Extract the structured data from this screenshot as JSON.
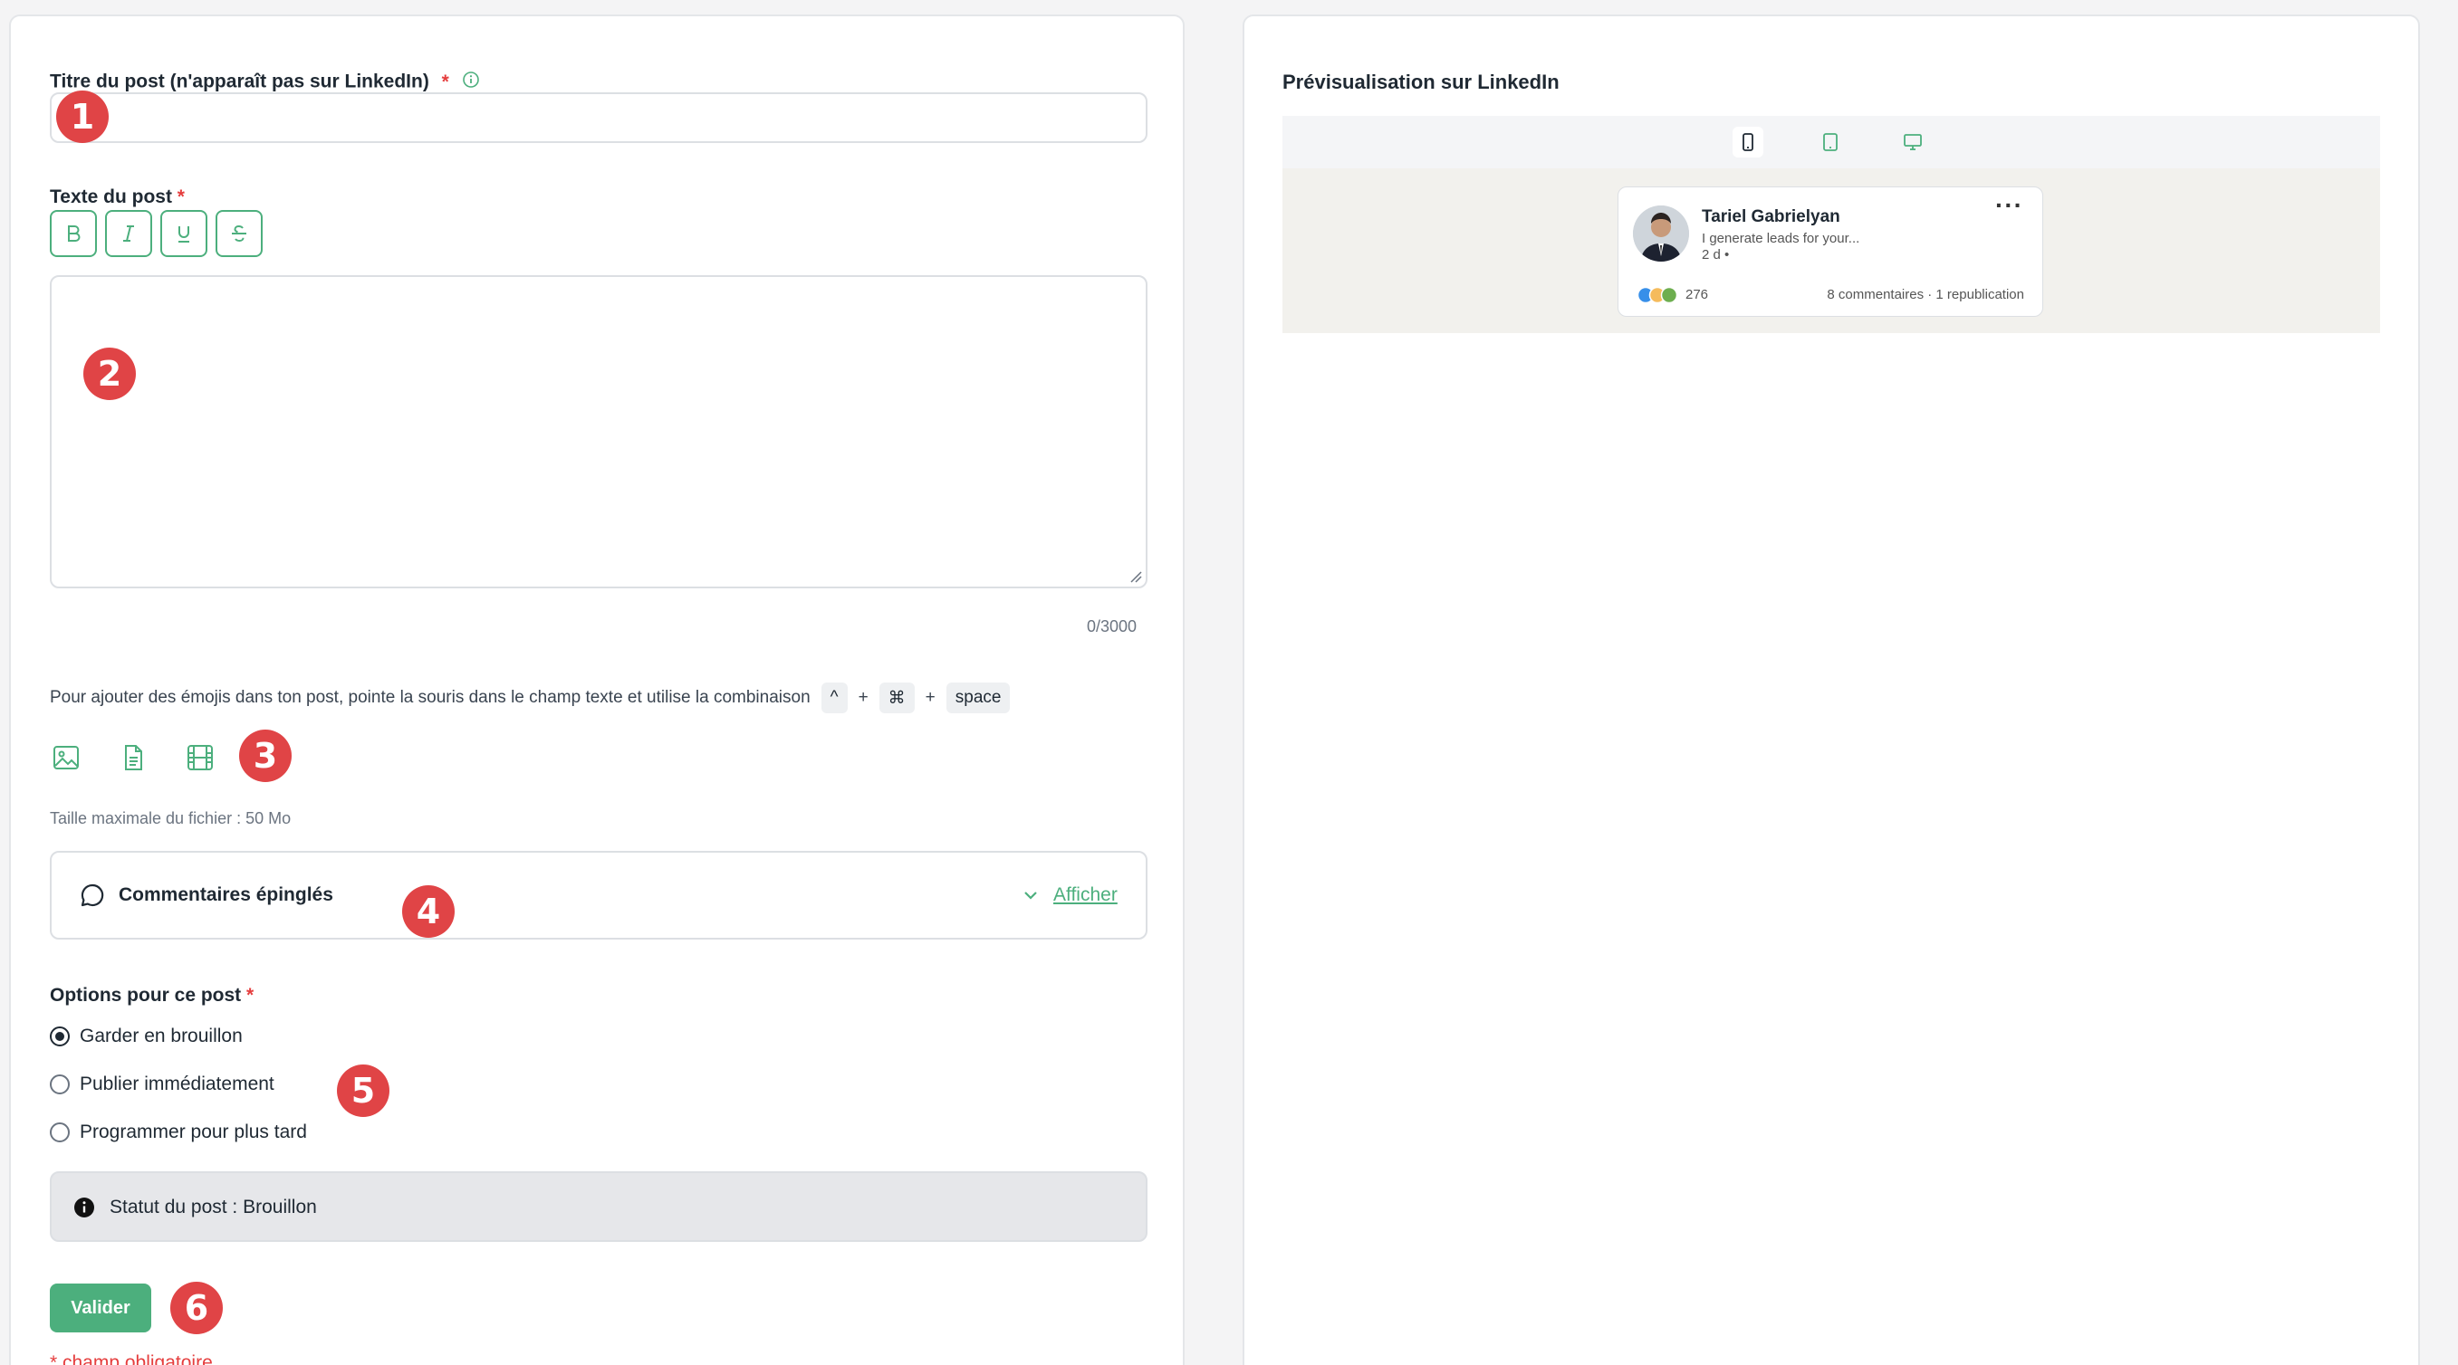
{
  "form": {
    "title_label": "Titre du post (n'apparaît pas sur LinkedIn)",
    "required_mark": "*",
    "title_value": "",
    "text_label": "Texte du post",
    "text_value": "",
    "char_count": "0/3000",
    "emoji_hint": "Pour ajouter des émojis dans ton post, pointe la souris dans le champ texte et utilise la combinaison",
    "keys": [
      "^",
      "⌘",
      "space"
    ],
    "key_separator": "+",
    "max_file_size": "Taille maximale du fichier : 50 Mo",
    "pinned_comments_label": "Commentaires épinglés",
    "show_label": "Afficher",
    "options_label": "Options pour ce post",
    "options": [
      {
        "label": "Garder en brouillon",
        "checked": true
      },
      {
        "label": "Publier immédiatement",
        "checked": false
      },
      {
        "label": "Programmer pour plus tard",
        "checked": false
      }
    ],
    "status_text": "Statut du post : Brouillon",
    "submit_label": "Valider",
    "required_note": "* champ obligatoire"
  },
  "format_buttons": [
    "bold-icon",
    "italic-icon",
    "underline-icon",
    "strikethrough-icon"
  ],
  "media_icons": [
    "image-icon",
    "document-icon",
    "video-icon"
  ],
  "badges": [
    "1",
    "2",
    "3",
    "4",
    "5",
    "6"
  ],
  "preview": {
    "title": "Prévisualisation sur LinkedIn",
    "devices": [
      "mobile-icon",
      "tablet-icon",
      "desktop-icon"
    ],
    "author_name": "Tariel Gabrielyan",
    "author_headline": "I generate leads for your...",
    "post_age": "2 d •",
    "reaction_count": "276",
    "engagement": "8 commentaires · 1 republication"
  },
  "colors": {
    "accent": "#4caf7d",
    "required": "#e53e3e",
    "badge": "#e04446",
    "status_bg": "#e6e7ea"
  }
}
